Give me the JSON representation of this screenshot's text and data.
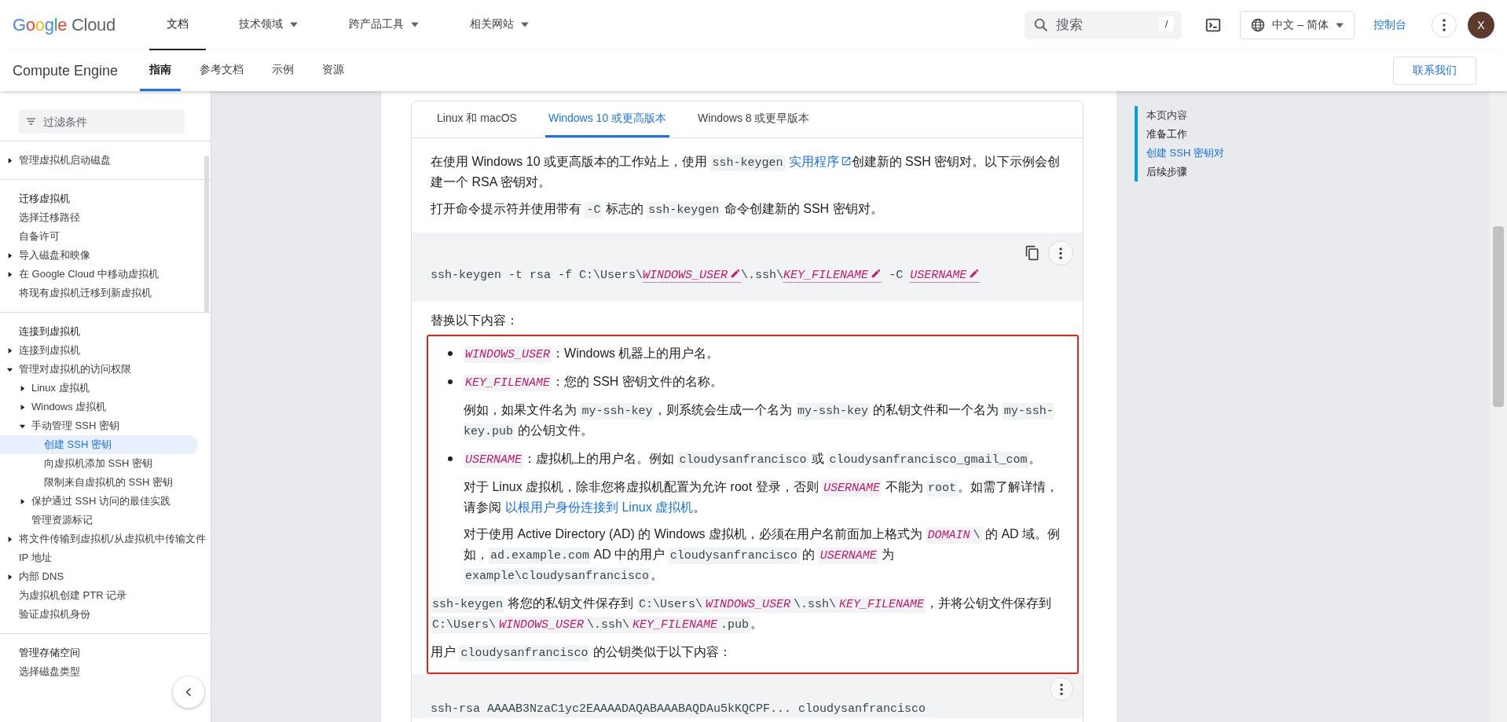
{
  "header": {
    "logo": {
      "word": "Google",
      "product": "Cloud"
    },
    "nav": [
      {
        "label": "文档",
        "selected": true,
        "dropdown": false
      },
      {
        "label": "技术领域",
        "selected": false,
        "dropdown": true
      },
      {
        "label": "跨产品工具",
        "selected": false,
        "dropdown": true
      },
      {
        "label": "相关网站",
        "selected": false,
        "dropdown": true
      }
    ],
    "search": {
      "placeholder": "搜索",
      "shortcut": "/"
    },
    "language": "中文 – 简体",
    "console": "控制台",
    "avatar": "X"
  },
  "subnav": {
    "product": "Compute Engine",
    "tabs": [
      {
        "label": "指南",
        "selected": true
      },
      {
        "label": "参考文档",
        "selected": false
      },
      {
        "label": "示例",
        "selected": false
      },
      {
        "label": "资源",
        "selected": false
      }
    ],
    "contact": "联系我们"
  },
  "sidebar": {
    "filter": {
      "placeholder": "过滤条件"
    },
    "sections": [
      {
        "items": [
          {
            "label": "管理虚拟机启动磁盘",
            "kind": "folder",
            "expanded": false,
            "selected": false
          }
        ]
      },
      {
        "items": [
          {
            "label": "迁移虚拟机",
            "kind": "heading",
            "selected": false
          },
          {
            "label": "选择迁移路径",
            "kind": "page",
            "selected": false
          },
          {
            "label": "自备许可",
            "kind": "page",
            "selected": false
          },
          {
            "label": "导入磁盘和映像",
            "kind": "folder",
            "expanded": false,
            "selected": false
          },
          {
            "label": "在 Google Cloud 中移动虚拟机",
            "kind": "folder",
            "expanded": false,
            "selected": false
          },
          {
            "label": "将现有虚拟机迁移到新虚拟机",
            "kind": "page",
            "selected": false
          }
        ]
      },
      {
        "items": [
          {
            "label": "连接到虚拟机",
            "kind": "heading",
            "selected": false
          },
          {
            "label": "连接到虚拟机",
            "kind": "folder",
            "expanded": false,
            "selected": false
          },
          {
            "label": "管理对虚拟机的访问权限",
            "kind": "folder",
            "expanded": true,
            "selected": false,
            "children": [
              {
                "label": "Linux 虚拟机",
                "kind": "folder",
                "expanded": false,
                "selected": false
              },
              {
                "label": "Windows 虚拟机",
                "kind": "folder",
                "expanded": false,
                "selected": false
              },
              {
                "label": "手动管理 SSH 密钥",
                "kind": "folder",
                "expanded": true,
                "selected": false,
                "children": [
                  {
                    "label": "创建 SSH 密钥",
                    "kind": "page",
                    "selected": true
                  },
                  {
                    "label": "向虚拟机添加 SSH 密钥",
                    "kind": "page",
                    "selected": false
                  },
                  {
                    "label": "限制来自虚拟机的 SSH 密钥",
                    "kind": "page",
                    "selected": false
                  }
                ]
              },
              {
                "label": "保护通过 SSH 访问的最佳实践",
                "kind": "folder",
                "expanded": false,
                "selected": false
              },
              {
                "label": "管理资源标记",
                "kind": "page",
                "selected": false
              }
            ]
          },
          {
            "label": "将文件传输到虚拟机/从虚拟机中传输文件",
            "kind": "folder",
            "expanded": false,
            "selected": false
          },
          {
            "label": "IP 地址",
            "kind": "page",
            "selected": false
          },
          {
            "label": "内部 DNS",
            "kind": "folder",
            "expanded": false,
            "selected": false
          },
          {
            "label": "为虚拟机创建 PTR 记录",
            "kind": "page",
            "selected": false
          },
          {
            "label": "验证虚拟机身份",
            "kind": "page",
            "selected": false
          }
        ]
      },
      {
        "items": [
          {
            "label": "管理存储空间",
            "kind": "heading",
            "selected": false
          },
          {
            "label": "选择磁盘类型",
            "kind": "page",
            "selected": false
          }
        ]
      }
    ]
  },
  "tabs": [
    {
      "label": "Linux 和 macOS",
      "selected": false
    },
    {
      "label": "Windows 10 或更高版本",
      "selected": true
    },
    {
      "label": "Windows 8 或更早版本",
      "selected": false
    }
  ],
  "intro": [
    {
      "kind": "paragraph",
      "segments": [
        {
          "kind": "text",
          "text": "在使用 Windows 10 或更高版本的工作站上，使用 "
        },
        {
          "kind": "code",
          "text": "ssh-keygen"
        },
        {
          "kind": "external_link",
          "text": "实用程序"
        },
        {
          "kind": "text",
          "text": "创建新的 SSH 密钥对。以下示例会创建一个 RSA 密钥对。"
        }
      ]
    },
    {
      "kind": "paragraph",
      "segments": [
        {
          "kind": "text",
          "text": "打开命令提示符并使用带有 "
        },
        {
          "kind": "code",
          "text": "-C"
        },
        {
          "kind": "text",
          "text": " 标志的 "
        },
        {
          "kind": "code",
          "text": "ssh-keygen"
        },
        {
          "kind": "text",
          "text": " 命令创建新的 SSH 密钥对。"
        }
      ]
    }
  ],
  "command": [
    {
      "kind": "text",
      "text": "ssh-keygen -t rsa -f C:\\Users\\"
    },
    {
      "kind": "var",
      "text": "WINDOWS_USER"
    },
    {
      "kind": "text",
      "text": "\\.ssh\\"
    },
    {
      "kind": "var",
      "text": "KEY_FILENAME"
    },
    {
      "kind": "text",
      "text": " -C "
    },
    {
      "kind": "var",
      "text": "USERNAME"
    }
  ],
  "replace_heading": "替换以下内容：",
  "highlighted": [
    {
      "kind": "bullet",
      "segments": [
        {
          "kind": "var",
          "text": "WINDOWS_USER"
        },
        {
          "kind": "text",
          "text": "：Windows 机器上的用户名。"
        }
      ]
    },
    {
      "kind": "bullet",
      "segments": [
        {
          "kind": "var",
          "text": "KEY_FILENAME"
        },
        {
          "kind": "text",
          "text": "：您的 SSH 密钥文件的名称。"
        }
      ]
    },
    {
      "kind": "indented",
      "segments": [
        {
          "kind": "text",
          "text": "例如，如果文件名为 "
        },
        {
          "kind": "code",
          "text": "my-ssh-key"
        },
        {
          "kind": "text",
          "text": "，则系统会生成一个名为 "
        },
        {
          "kind": "code",
          "text": "my-ssh-key"
        },
        {
          "kind": "text",
          "text": " 的私钥文件和一个名为 "
        },
        {
          "kind": "code",
          "text": "my-ssh-key.pub"
        },
        {
          "kind": "text",
          "text": " 的公钥文件。"
        }
      ]
    },
    {
      "kind": "bullet",
      "segments": [
        {
          "kind": "var",
          "text": "USERNAME"
        },
        {
          "kind": "text",
          "text": "：虚拟机上的用户名。例如 "
        },
        {
          "kind": "code",
          "text": "cloudysanfrancisco"
        },
        {
          "kind": "text",
          "text": " 或 "
        },
        {
          "kind": "code",
          "text": "cloudysanfrancisco_gmail_com"
        },
        {
          "kind": "text",
          "text": "。"
        }
      ]
    },
    {
      "kind": "indented",
      "segments": [
        {
          "kind": "text",
          "text": "对于 Linux 虚拟机，除非您将虚拟机配置为允许 root 登录，否则 "
        },
        {
          "kind": "var",
          "text": "USERNAME"
        },
        {
          "kind": "text",
          "text": " 不能为 "
        },
        {
          "kind": "code",
          "text": "root"
        },
        {
          "kind": "text",
          "text": "。如需了解详情，请参阅"
        },
        {
          "kind": "link",
          "text": "以根用户身份连接到 Linux 虚拟机"
        },
        {
          "kind": "text",
          "text": "。"
        }
      ]
    },
    {
      "kind": "indented",
      "segments": [
        {
          "kind": "text",
          "text": "对于使用 Active Directory (AD) 的 Windows 虚拟机，必须在用户名前面加上格式为 "
        },
        {
          "kind": "var",
          "text": "DOMAIN"
        },
        {
          "kind": "code",
          "text": "\\"
        },
        {
          "kind": "text",
          "text": " 的 AD 域。例如，"
        },
        {
          "kind": "code",
          "text": "ad.example.com"
        },
        {
          "kind": "text",
          "text": " AD 中的用户 "
        },
        {
          "kind": "code",
          "text": "cloudysanfrancisco"
        },
        {
          "kind": "text",
          "text": " 的 "
        },
        {
          "kind": "var",
          "text": "USERNAME"
        },
        {
          "kind": "text",
          "text": " 为 "
        },
        {
          "kind": "code",
          "text": "example\\cloudysanfrancisco"
        },
        {
          "kind": "text",
          "text": "。"
        }
      ]
    },
    {
      "kind": "paragraph",
      "segments": [
        {
          "kind": "code",
          "text": "ssh-keygen"
        },
        {
          "kind": "text",
          "text": " 将您的私钥文件保存到 "
        },
        {
          "kind": "code",
          "text": "C:\\Users\\"
        },
        {
          "kind": "var",
          "text": "WINDOWS_USER"
        },
        {
          "kind": "code",
          "text": "\\.ssh\\"
        },
        {
          "kind": "var",
          "text": "KEY_FILENAME"
        },
        {
          "kind": "text",
          "text": "，并将公钥文件保存到 "
        },
        {
          "kind": "code",
          "text": "C:\\Users\\"
        },
        {
          "kind": "var",
          "text": "WINDOWS_USER"
        },
        {
          "kind": "code",
          "text": "\\.ssh\\"
        },
        {
          "kind": "var",
          "text": "KEY_FILENAME"
        },
        {
          "kind": "code",
          "text": ".pub"
        },
        {
          "kind": "text",
          "text": "。"
        }
      ]
    },
    {
      "kind": "paragraph",
      "segments": [
        {
          "kind": "text",
          "text": "用户 "
        },
        {
          "kind": "code",
          "text": "cloudysanfrancisco"
        },
        {
          "kind": "text",
          "text": " 的公钥类似于以下内容："
        }
      ]
    }
  ],
  "output": "ssh-rsa AAAAB3NzaC1yc2EAAAADAQABAAABAQDAu5kKQCPF... cloudysanfrancisco",
  "toc": {
    "title": "本页内容",
    "items": [
      {
        "label": "准备工作",
        "selected": false
      },
      {
        "label": "创建 SSH 密钥对",
        "selected": true
      },
      {
        "label": "后续步骤",
        "selected": false
      }
    ]
  }
}
